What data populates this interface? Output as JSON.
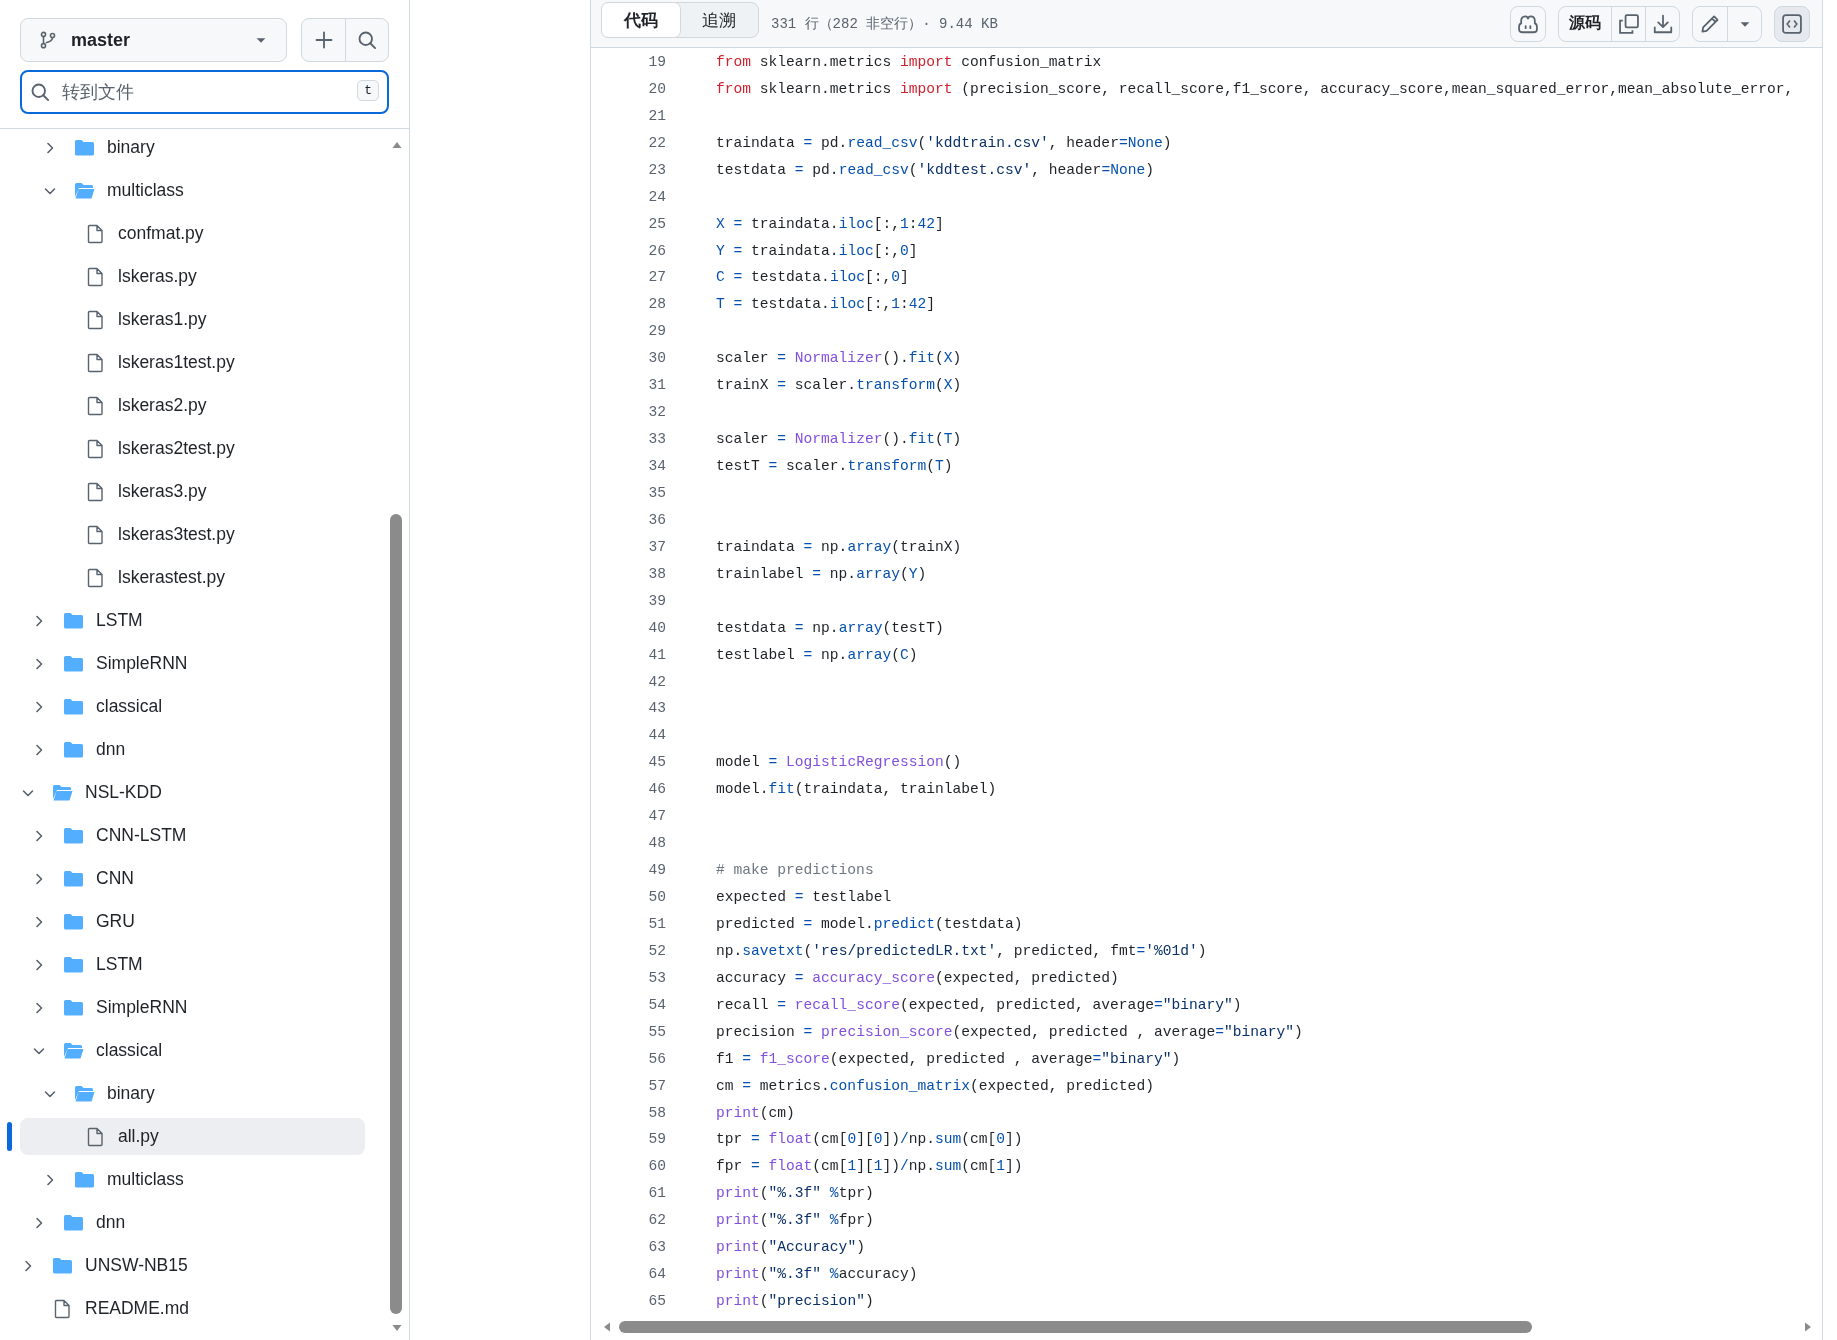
{
  "sidebar": {
    "branch": "master",
    "search": {
      "placeholder": "转到文件",
      "shortcut": "t"
    },
    "tree": [
      {
        "children": [
          {
            "children": [
              {
                "label": "binary",
                "kind": "folder",
                "expanded": false,
                "selected": false
              },
              {
                "label": "multiclass",
                "kind": "folder",
                "expanded": true,
                "selected": false,
                "children": [
                  {
                    "label": "confmat.py",
                    "kind": "file",
                    "selected": false
                  },
                  {
                    "label": "lskeras.py",
                    "kind": "file",
                    "selected": false
                  },
                  {
                    "label": "lskeras1.py",
                    "kind": "file",
                    "selected": false
                  },
                  {
                    "label": "lskeras1test.py",
                    "kind": "file",
                    "selected": false
                  },
                  {
                    "label": "lskeras2.py",
                    "kind": "file",
                    "selected": false
                  },
                  {
                    "label": "lskeras2test.py",
                    "kind": "file",
                    "selected": false
                  },
                  {
                    "label": "lskeras3.py",
                    "kind": "file",
                    "selected": false
                  },
                  {
                    "label": "lskeras3test.py",
                    "kind": "file",
                    "selected": false
                  },
                  {
                    "label": "lskerastest.py",
                    "kind": "file",
                    "selected": false
                  }
                ]
              }
            ]
          },
          {
            "label": "LSTM",
            "kind": "folder",
            "expanded": false,
            "selected": false
          },
          {
            "label": "SimpleRNN",
            "kind": "folder",
            "expanded": false,
            "selected": false
          },
          {
            "label": "classical",
            "kind": "folder",
            "expanded": false,
            "selected": false
          },
          {
            "label": "dnn",
            "kind": "folder",
            "expanded": false,
            "selected": false
          }
        ]
      },
      {
        "label": "NSL-KDD",
        "kind": "folder",
        "expanded": true,
        "selected": false,
        "children": [
          {
            "label": "CNN-LSTM",
            "kind": "folder",
            "expanded": false,
            "selected": false
          },
          {
            "label": "CNN",
            "kind": "folder",
            "expanded": false,
            "selected": false
          },
          {
            "label": "GRU",
            "kind": "folder",
            "expanded": false,
            "selected": false
          },
          {
            "label": "LSTM",
            "kind": "folder",
            "expanded": false,
            "selected": false
          },
          {
            "label": "SimpleRNN",
            "kind": "folder",
            "expanded": false,
            "selected": false
          },
          {
            "label": "classical",
            "kind": "folder",
            "expanded": true,
            "selected": false,
            "children": [
              {
                "label": "binary",
                "kind": "folder",
                "expanded": true,
                "selected": false,
                "children": [
                  {
                    "label": "all.py",
                    "kind": "file",
                    "selected": true
                  }
                ]
              },
              {
                "label": "multiclass",
                "kind": "folder",
                "expanded": false,
                "selected": false
              }
            ]
          },
          {
            "label": "dnn",
            "kind": "folder",
            "expanded": false,
            "selected": false
          }
        ]
      },
      {
        "label": "UNSW-NB15",
        "kind": "folder",
        "expanded": false,
        "selected": false
      },
      {
        "label": "README.md",
        "kind": "file",
        "selected": false
      }
    ]
  },
  "toolbar": {
    "tabs": [
      {
        "label": "代码",
        "selected": true
      },
      {
        "label": "追溯",
        "selected": false
      }
    ],
    "file_info": "331 行（282 非空行）· 9.44 KB",
    "raw_button": "源码",
    "symbols_button": {
      "selected": true
    }
  },
  "code": {
    "lines": [
      {
        "number": "19",
        "tokens": [
          {
            "kind": "kw",
            "text": "from"
          },
          {
            "kind": "plain",
            "text": " sklearn.metrics "
          },
          {
            "kind": "kw",
            "text": "import"
          },
          {
            "kind": "plain",
            "text": " confusion_matrix"
          }
        ]
      },
      {
        "number": "20",
        "tokens": [
          {
            "kind": "kw",
            "text": "from"
          },
          {
            "kind": "plain",
            "text": " sklearn.metrics "
          },
          {
            "kind": "kw",
            "text": "import"
          },
          {
            "kind": "plain",
            "text": " (precision_score, recall_score,f1_score, accuracy_score,mean_squared_error,mean_absolute_error,"
          }
        ]
      },
      {
        "number": "21"
      },
      {
        "number": "22",
        "tokens": [
          {
            "kind": "plain",
            "text": "traindata"
          },
          {
            "kind": "op",
            "text": " = "
          },
          {
            "kind": "plain",
            "text": "pd."
          },
          {
            "kind": "prop",
            "text": "read_csv"
          },
          {
            "kind": "plain",
            "text": "("
          },
          {
            "kind": "str",
            "text": "'kddtrain.csv'"
          },
          {
            "kind": "plain",
            "text": ", header"
          },
          {
            "kind": "op",
            "text": "="
          },
          {
            "kind": "const",
            "text": "None"
          },
          {
            "kind": "plain",
            "text": ")"
          }
        ]
      },
      {
        "number": "23",
        "tokens": [
          {
            "kind": "plain",
            "text": "testdata"
          },
          {
            "kind": "op",
            "text": " = "
          },
          {
            "kind": "plain",
            "text": "pd."
          },
          {
            "kind": "prop",
            "text": "read_csv"
          },
          {
            "kind": "plain",
            "text": "("
          },
          {
            "kind": "str",
            "text": "'kddtest.csv'"
          },
          {
            "kind": "plain",
            "text": ", header"
          },
          {
            "kind": "op",
            "text": "="
          },
          {
            "kind": "const",
            "text": "None"
          },
          {
            "kind": "plain",
            "text": ")"
          }
        ]
      },
      {
        "number": "24"
      },
      {
        "number": "25",
        "tokens": [
          {
            "kind": "const",
            "text": "X"
          },
          {
            "kind": "op",
            "text": " = "
          },
          {
            "kind": "plain",
            "text": "traindata."
          },
          {
            "kind": "prop",
            "text": "iloc"
          },
          {
            "kind": "plain",
            "text": "[:,"
          },
          {
            "kind": "const",
            "text": "1"
          },
          {
            "kind": "plain",
            "text": ":"
          },
          {
            "kind": "const",
            "text": "42"
          },
          {
            "kind": "plain",
            "text": "]"
          }
        ]
      },
      {
        "number": "26",
        "tokens": [
          {
            "kind": "const",
            "text": "Y"
          },
          {
            "kind": "op",
            "text": " = "
          },
          {
            "kind": "plain",
            "text": "traindata."
          },
          {
            "kind": "prop",
            "text": "iloc"
          },
          {
            "kind": "plain",
            "text": "[:,"
          },
          {
            "kind": "const",
            "text": "0"
          },
          {
            "kind": "plain",
            "text": "]"
          }
        ]
      },
      {
        "number": "27",
        "tokens": [
          {
            "kind": "const",
            "text": "C"
          },
          {
            "kind": "op",
            "text": " = "
          },
          {
            "kind": "plain",
            "text": "testdata."
          },
          {
            "kind": "prop",
            "text": "iloc"
          },
          {
            "kind": "plain",
            "text": "[:,"
          },
          {
            "kind": "const",
            "text": "0"
          },
          {
            "kind": "plain",
            "text": "]"
          }
        ]
      },
      {
        "number": "28",
        "tokens": [
          {
            "kind": "const",
            "text": "T"
          },
          {
            "kind": "op",
            "text": " = "
          },
          {
            "kind": "plain",
            "text": "testdata."
          },
          {
            "kind": "prop",
            "text": "iloc"
          },
          {
            "kind": "plain",
            "text": "[:,"
          },
          {
            "kind": "const",
            "text": "1"
          },
          {
            "kind": "plain",
            "text": ":"
          },
          {
            "kind": "const",
            "text": "42"
          },
          {
            "kind": "plain",
            "text": "]"
          }
        ]
      },
      {
        "number": "29"
      },
      {
        "number": "30",
        "tokens": [
          {
            "kind": "plain",
            "text": "scaler"
          },
          {
            "kind": "op",
            "text": " = "
          },
          {
            "kind": "fn",
            "text": "Normalizer"
          },
          {
            "kind": "plain",
            "text": "()."
          },
          {
            "kind": "prop",
            "text": "fit"
          },
          {
            "kind": "plain",
            "text": "("
          },
          {
            "kind": "const",
            "text": "X"
          },
          {
            "kind": "plain",
            "text": ")"
          }
        ]
      },
      {
        "number": "31",
        "tokens": [
          {
            "kind": "plain",
            "text": "trainX"
          },
          {
            "kind": "op",
            "text": " = "
          },
          {
            "kind": "plain",
            "text": "scaler."
          },
          {
            "kind": "prop",
            "text": "transform"
          },
          {
            "kind": "plain",
            "text": "("
          },
          {
            "kind": "const",
            "text": "X"
          },
          {
            "kind": "plain",
            "text": ")"
          }
        ]
      },
      {
        "number": "32"
      },
      {
        "number": "33",
        "tokens": [
          {
            "kind": "plain",
            "text": "scaler"
          },
          {
            "kind": "op",
            "text": " = "
          },
          {
            "kind": "fn",
            "text": "Normalizer"
          },
          {
            "kind": "plain",
            "text": "()."
          },
          {
            "kind": "prop",
            "text": "fit"
          },
          {
            "kind": "plain",
            "text": "("
          },
          {
            "kind": "const",
            "text": "T"
          },
          {
            "kind": "plain",
            "text": ")"
          }
        ]
      },
      {
        "number": "34",
        "tokens": [
          {
            "kind": "plain",
            "text": "testT"
          },
          {
            "kind": "op",
            "text": " = "
          },
          {
            "kind": "plain",
            "text": "scaler."
          },
          {
            "kind": "prop",
            "text": "transform"
          },
          {
            "kind": "plain",
            "text": "("
          },
          {
            "kind": "const",
            "text": "T"
          },
          {
            "kind": "plain",
            "text": ")"
          }
        ]
      },
      {
        "number": "35"
      },
      {
        "number": "36"
      },
      {
        "number": "37",
        "tokens": [
          {
            "kind": "plain",
            "text": "traindata"
          },
          {
            "kind": "op",
            "text": " = "
          },
          {
            "kind": "plain",
            "text": "np."
          },
          {
            "kind": "prop",
            "text": "array"
          },
          {
            "kind": "plain",
            "text": "(trainX)"
          }
        ]
      },
      {
        "number": "38",
        "tokens": [
          {
            "kind": "plain",
            "text": "trainlabel"
          },
          {
            "kind": "op",
            "text": " = "
          },
          {
            "kind": "plain",
            "text": "np."
          },
          {
            "kind": "prop",
            "text": "array"
          },
          {
            "kind": "plain",
            "text": "("
          },
          {
            "kind": "const",
            "text": "Y"
          },
          {
            "kind": "plain",
            "text": ")"
          }
        ]
      },
      {
        "number": "39"
      },
      {
        "number": "40",
        "tokens": [
          {
            "kind": "plain",
            "text": "testdata"
          },
          {
            "kind": "op",
            "text": " = "
          },
          {
            "kind": "plain",
            "text": "np."
          },
          {
            "kind": "prop",
            "text": "array"
          },
          {
            "kind": "plain",
            "text": "(testT)"
          }
        ]
      },
      {
        "number": "41",
        "tokens": [
          {
            "kind": "plain",
            "text": "testlabel"
          },
          {
            "kind": "op",
            "text": " = "
          },
          {
            "kind": "plain",
            "text": "np."
          },
          {
            "kind": "prop",
            "text": "array"
          },
          {
            "kind": "plain",
            "text": "("
          },
          {
            "kind": "const",
            "text": "C"
          },
          {
            "kind": "plain",
            "text": ")"
          }
        ]
      },
      {
        "number": "42"
      },
      {
        "number": "43"
      },
      {
        "number": "44"
      },
      {
        "number": "45",
        "tokens": [
          {
            "kind": "plain",
            "text": "model"
          },
          {
            "kind": "op",
            "text": " = "
          },
          {
            "kind": "fn",
            "text": "LogisticRegression"
          },
          {
            "kind": "plain",
            "text": "()"
          }
        ]
      },
      {
        "number": "46",
        "tokens": [
          {
            "kind": "plain",
            "text": "model."
          },
          {
            "kind": "prop",
            "text": "fit"
          },
          {
            "kind": "plain",
            "text": "(traindata, trainlabel)"
          }
        ]
      },
      {
        "number": "47"
      },
      {
        "number": "48"
      },
      {
        "number": "49",
        "tokens": [
          {
            "kind": "cm",
            "text": "# make predictions"
          }
        ]
      },
      {
        "number": "50",
        "tokens": [
          {
            "kind": "plain",
            "text": "expected"
          },
          {
            "kind": "op",
            "text": " = "
          },
          {
            "kind": "plain",
            "text": "testlabel"
          }
        ]
      },
      {
        "number": "51",
        "tokens": [
          {
            "kind": "plain",
            "text": "predicted"
          },
          {
            "kind": "op",
            "text": " = "
          },
          {
            "kind": "plain",
            "text": "model."
          },
          {
            "kind": "prop",
            "text": "predict"
          },
          {
            "kind": "plain",
            "text": "(testdata)"
          }
        ]
      },
      {
        "number": "52",
        "tokens": [
          {
            "kind": "plain",
            "text": "np."
          },
          {
            "kind": "prop",
            "text": "savetxt"
          },
          {
            "kind": "plain",
            "text": "("
          },
          {
            "kind": "str",
            "text": "'res/predictedLR.txt'"
          },
          {
            "kind": "plain",
            "text": ", predicted, fmt"
          },
          {
            "kind": "op",
            "text": "="
          },
          {
            "kind": "str",
            "text": "'%01d'"
          },
          {
            "kind": "plain",
            "text": ")"
          }
        ]
      },
      {
        "number": "53",
        "tokens": [
          {
            "kind": "plain",
            "text": "accuracy"
          },
          {
            "kind": "op",
            "text": " = "
          },
          {
            "kind": "fn",
            "text": "accuracy_score"
          },
          {
            "kind": "plain",
            "text": "(expected, predicted)"
          }
        ]
      },
      {
        "number": "54",
        "tokens": [
          {
            "kind": "plain",
            "text": "recall"
          },
          {
            "kind": "op",
            "text": " = "
          },
          {
            "kind": "fn",
            "text": "recall_score"
          },
          {
            "kind": "plain",
            "text": "(expected, predicted, average"
          },
          {
            "kind": "op",
            "text": "="
          },
          {
            "kind": "str",
            "text": "\"binary\""
          },
          {
            "kind": "plain",
            "text": ")"
          }
        ]
      },
      {
        "number": "55",
        "tokens": [
          {
            "kind": "plain",
            "text": "precision"
          },
          {
            "kind": "op",
            "text": " = "
          },
          {
            "kind": "fn",
            "text": "precision_score"
          },
          {
            "kind": "plain",
            "text": "(expected, predicted , average"
          },
          {
            "kind": "op",
            "text": "="
          },
          {
            "kind": "str",
            "text": "\"binary\""
          },
          {
            "kind": "plain",
            "text": ")"
          }
        ]
      },
      {
        "number": "56",
        "tokens": [
          {
            "kind": "plain",
            "text": "f1"
          },
          {
            "kind": "op",
            "text": " = "
          },
          {
            "kind": "fn",
            "text": "f1_score"
          },
          {
            "kind": "plain",
            "text": "(expected, predicted , average"
          },
          {
            "kind": "op",
            "text": "="
          },
          {
            "kind": "str",
            "text": "\"binary\""
          },
          {
            "kind": "plain",
            "text": ")"
          }
        ]
      },
      {
        "number": "57",
        "tokens": [
          {
            "kind": "plain",
            "text": "cm"
          },
          {
            "kind": "op",
            "text": " = "
          },
          {
            "kind": "plain",
            "text": "metrics."
          },
          {
            "kind": "prop",
            "text": "confusion_matrix"
          },
          {
            "kind": "plain",
            "text": "(expected, predicted)"
          }
        ]
      },
      {
        "number": "58",
        "tokens": [
          {
            "kind": "fn",
            "text": "print"
          },
          {
            "kind": "plain",
            "text": "(cm)"
          }
        ]
      },
      {
        "number": "59",
        "tokens": [
          {
            "kind": "plain",
            "text": "tpr"
          },
          {
            "kind": "op",
            "text": " = "
          },
          {
            "kind": "fn",
            "text": "float"
          },
          {
            "kind": "plain",
            "text": "(cm["
          },
          {
            "kind": "const",
            "text": "0"
          },
          {
            "kind": "plain",
            "text": "]["
          },
          {
            "kind": "const",
            "text": "0"
          },
          {
            "kind": "plain",
            "text": "])"
          },
          {
            "kind": "op",
            "text": "/"
          },
          {
            "kind": "plain",
            "text": "np."
          },
          {
            "kind": "prop",
            "text": "sum"
          },
          {
            "kind": "plain",
            "text": "(cm["
          },
          {
            "kind": "const",
            "text": "0"
          },
          {
            "kind": "plain",
            "text": "])"
          }
        ]
      },
      {
        "number": "60",
        "tokens": [
          {
            "kind": "plain",
            "text": "fpr"
          },
          {
            "kind": "op",
            "text": " = "
          },
          {
            "kind": "fn",
            "text": "float"
          },
          {
            "kind": "plain",
            "text": "(cm["
          },
          {
            "kind": "const",
            "text": "1"
          },
          {
            "kind": "plain",
            "text": "]["
          },
          {
            "kind": "const",
            "text": "1"
          },
          {
            "kind": "plain",
            "text": "])"
          },
          {
            "kind": "op",
            "text": "/"
          },
          {
            "kind": "plain",
            "text": "np."
          },
          {
            "kind": "prop",
            "text": "sum"
          },
          {
            "kind": "plain",
            "text": "(cm["
          },
          {
            "kind": "const",
            "text": "1"
          },
          {
            "kind": "plain",
            "text": "])"
          }
        ]
      },
      {
        "number": "61",
        "tokens": [
          {
            "kind": "fn",
            "text": "print"
          },
          {
            "kind": "plain",
            "text": "("
          },
          {
            "kind": "str",
            "text": "\"%.3f\""
          },
          {
            "kind": "op",
            "text": " %"
          },
          {
            "kind": "plain",
            "text": "tpr)"
          }
        ]
      },
      {
        "number": "62",
        "tokens": [
          {
            "kind": "fn",
            "text": "print"
          },
          {
            "kind": "plain",
            "text": "("
          },
          {
            "kind": "str",
            "text": "\"%.3f\""
          },
          {
            "kind": "op",
            "text": " %"
          },
          {
            "kind": "plain",
            "text": "fpr)"
          }
        ]
      },
      {
        "number": "63",
        "tokens": [
          {
            "kind": "fn",
            "text": "print"
          },
          {
            "kind": "plain",
            "text": "("
          },
          {
            "kind": "str",
            "text": "\"Accuracy\""
          },
          {
            "kind": "plain",
            "text": ")"
          }
        ]
      },
      {
        "number": "64",
        "tokens": [
          {
            "kind": "fn",
            "text": "print"
          },
          {
            "kind": "plain",
            "text": "("
          },
          {
            "kind": "str",
            "text": "\"%.3f\""
          },
          {
            "kind": "op",
            "text": " %"
          },
          {
            "kind": "plain",
            "text": "accuracy)"
          }
        ]
      },
      {
        "number": "65",
        "tokens": [
          {
            "kind": "fn",
            "text": "print"
          },
          {
            "kind": "plain",
            "text": "("
          },
          {
            "kind": "str",
            "text": "\"precision\""
          },
          {
            "kind": "plain",
            "text": ")"
          }
        ]
      }
    ]
  }
}
